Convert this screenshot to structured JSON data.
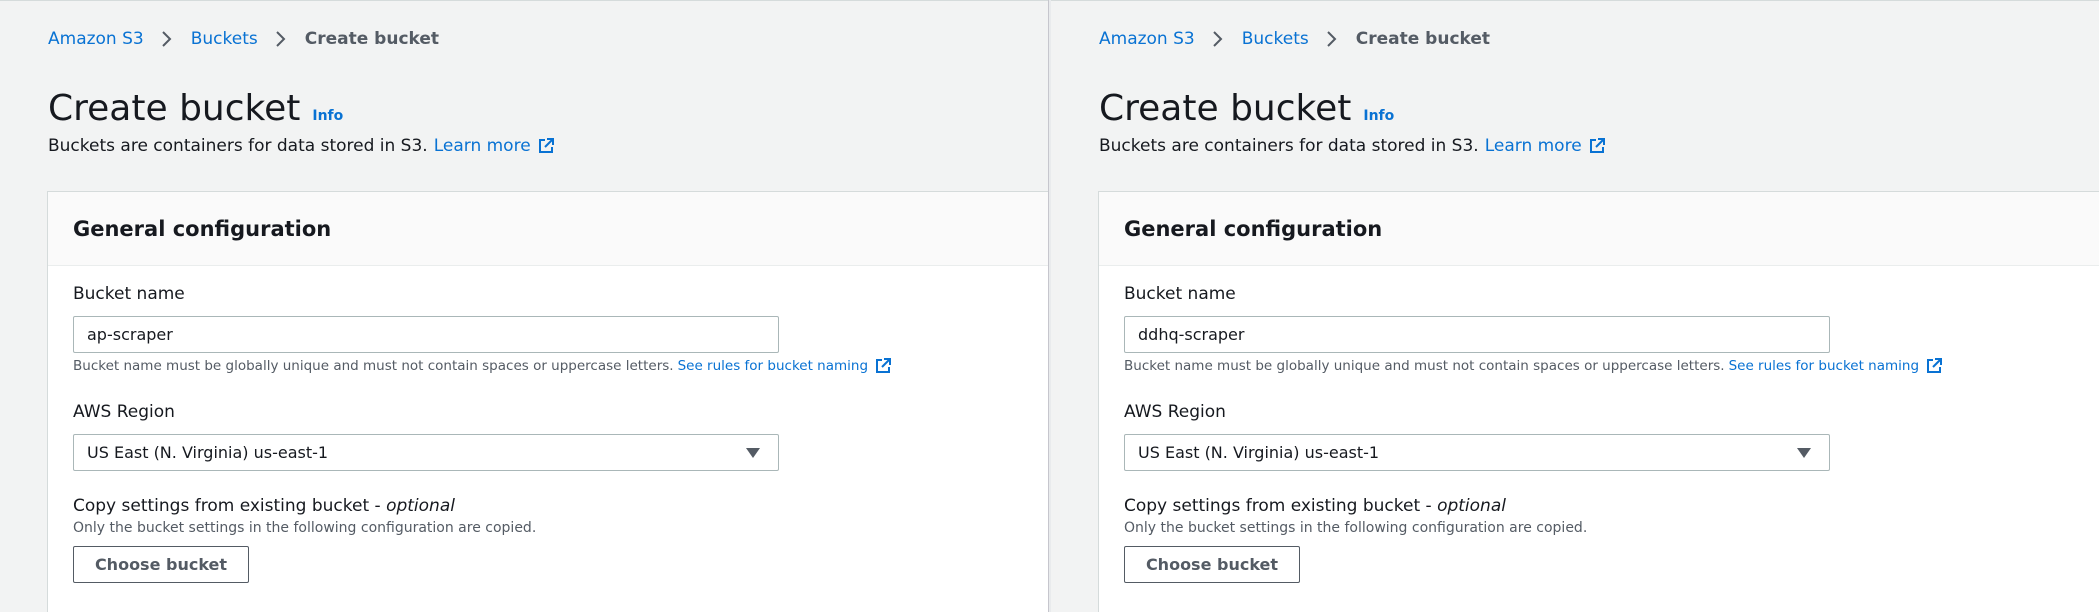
{
  "colors": {
    "link": "#0972d3",
    "page_background": "#f2f3f3",
    "panel_header_background": "#fafafa",
    "text": "#16191f",
    "muted_text": "#545b64",
    "border": "#aab7b8"
  },
  "icons": {
    "breadcrumb_separator": "chevron-right-icon",
    "external_link": "external-link-icon",
    "dropdown": "caret-down-icon"
  },
  "panes": [
    {
      "breadcrumb": [
        "Amazon S3",
        "Buckets",
        "Create bucket"
      ],
      "title": "Create bucket",
      "info": "Info",
      "description": "Buckets are containers for data stored in S3.",
      "learn_more": "Learn more",
      "panel_title": "General configuration",
      "bucket_name_label": "Bucket name",
      "bucket_name_value": "ap-scraper",
      "bucket_name_hint": "Bucket name must be globally unique and must not contain spaces or uppercase letters.",
      "rules_link": "See rules for bucket naming",
      "region_label": "AWS Region",
      "region_value": "US East (N. Virginia) us-east-1",
      "copy_label": "Copy settings from existing bucket - ",
      "copy_optional": "optional",
      "copy_desc": "Only the bucket settings in the following configuration are copied.",
      "choose_button": "Choose bucket"
    },
    {
      "breadcrumb": [
        "Amazon S3",
        "Buckets",
        "Create bucket"
      ],
      "title": "Create bucket",
      "info": "Info",
      "description": "Buckets are containers for data stored in S3.",
      "learn_more": "Learn more",
      "panel_title": "General configuration",
      "bucket_name_label": "Bucket name",
      "bucket_name_value": "ddhq-scraper",
      "bucket_name_hint": "Bucket name must be globally unique and must not contain spaces or uppercase letters.",
      "rules_link": "See rules for bucket naming",
      "region_label": "AWS Region",
      "region_value": "US East (N. Virginia) us-east-1",
      "copy_label": "Copy settings from existing bucket - ",
      "copy_optional": "optional",
      "copy_desc": "Only the bucket settings in the following configuration are copied.",
      "choose_button": "Choose bucket"
    }
  ]
}
